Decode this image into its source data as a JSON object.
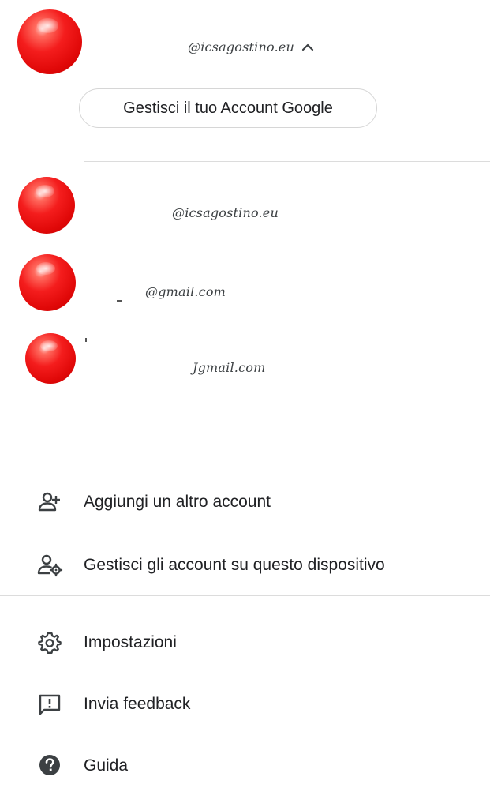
{
  "current_account": {
    "email": "@icsagostino.eu",
    "manage_button_label": "Gestisci il tuo Account Google"
  },
  "other_accounts": [
    {
      "email": "@icsagostino.eu"
    },
    {
      "email": "@gmail.com"
    },
    {
      "email": "Jgmail.com"
    }
  ],
  "menu": {
    "add_account": {
      "label": "Aggiungi un altro account",
      "icon": "person-add-icon"
    },
    "manage_device_accounts": {
      "label": "Gestisci gli account su questo dispositivo",
      "icon": "manage-accounts-icon"
    },
    "settings": {
      "label": "Impostazioni",
      "icon": "gear-icon"
    },
    "feedback": {
      "label": "Invia feedback",
      "icon": "feedback-icon"
    },
    "help": {
      "label": "Guida",
      "icon": "help-icon"
    }
  },
  "colors": {
    "avatar_red": "#e8100f",
    "text_primary": "#202124",
    "icon_color": "#3c4043",
    "divider": "#dcdcdc"
  }
}
